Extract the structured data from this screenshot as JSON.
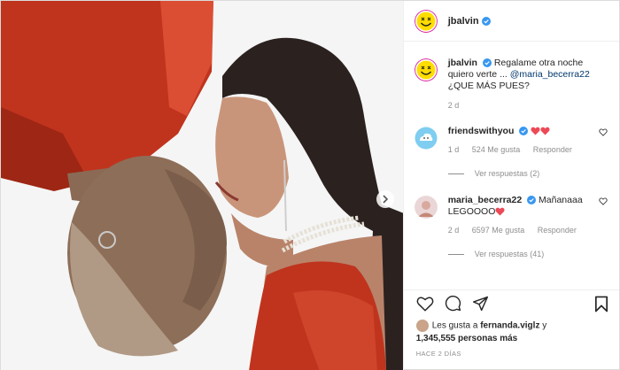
{
  "post": {
    "username": "jbalvin",
    "caption": {
      "text_before": "Regalame otra noche quiero verte ...",
      "mention": "@maria_becerra22",
      "text_after": "¿QUE MÁS PUES?",
      "age": "2 d"
    },
    "comments": [
      {
        "username": "friendswithyou",
        "text": "",
        "age": "1 d",
        "likes": "524 Me gusta",
        "reply_label": "Responder",
        "view_replies": "Ver respuestas (2)"
      },
      {
        "username": "maria_becerra22",
        "text": "Mañanaaa LEGOOOO",
        "age": "2 d",
        "likes": "6597 Me gusta",
        "reply_label": "Responder",
        "view_replies": "Ver respuestas (41)"
      }
    ],
    "likes_line_1": "Les gusta a",
    "likes_user": "fernanda.viglz",
    "likes_line_2": "y",
    "likes_count": "1,345,555",
    "likes_line_3": "personas más",
    "timestamp": "HACE 2 DÍAS"
  },
  "colors": {
    "verified": "#3897f0",
    "heart_red": "#ed4956",
    "brand_yellow": "#ffdd00",
    "muted": "#8e8e8e"
  },
  "icons": [
    "smiley-logo-icon",
    "verified-icon",
    "heart-icon",
    "comment-icon",
    "share-icon",
    "bookmark-icon",
    "chevron-right-icon"
  ]
}
